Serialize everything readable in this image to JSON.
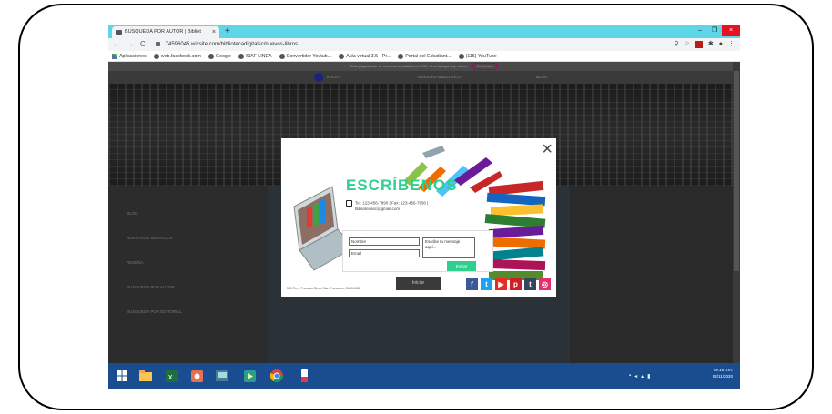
{
  "browser": {
    "tab_title": "BUSQUEDA POR AUTOR | Bibliot",
    "tab_close": "×",
    "new_tab": "+",
    "window_controls": {
      "minimize": "–",
      "maximize": "❐",
      "close": "×"
    },
    "nav": {
      "back": "←",
      "forward": "→",
      "reload": "C"
    },
    "url": "74596045.wixsite.com/bibliotecadigitalsc/nuevos-libros",
    "right_icons": [
      "search-icon",
      "star-icon",
      "extension-icon",
      "puzzle-icon",
      "profile-icon",
      "menu-icon"
    ],
    "right_icon_glyphs": {
      "search": "⚲",
      "star": "☆",
      "puzzle": "✱",
      "profile": "●",
      "menu": "⋮"
    },
    "bookmarks": [
      {
        "label": "Aplicaciones"
      },
      {
        "label": "web.facebook.com"
      },
      {
        "label": "Google"
      },
      {
        "label": "SIAF LINEA"
      },
      {
        "label": "Convertidor Youtub..."
      },
      {
        "label": "Aula virtual 3.5 - Pr..."
      },
      {
        "label": "Portal del Estudiant..."
      },
      {
        "label": "(115) YouTube"
      }
    ]
  },
  "site": {
    "promo_text": "Esta página web se creó con la plataforma WIX. Crea la tuya hoy mismo",
    "promo_button": "Comenzar",
    "nav": [
      "INICIO",
      "NUESTRA BIBLIOTECA",
      "BLOG"
    ],
    "sidebar": [
      "BLOG",
      "NUESTROS SERVICIOS",
      "RESEÑA",
      "BUSQUEDA POR AUTOR",
      "BUSQUEDA POR EDITORIAL"
    ]
  },
  "modal": {
    "close": "×",
    "title": "ESCRÍBENOS",
    "contact_line1": "Tel: 123-456-7890 | Fax: 123-456-7890 |",
    "contact_line2": "Bibliotecasc@gmail.com",
    "name_placeholder": "Nombre",
    "email_placeholder": "Email",
    "message_placeholder": "Escribe tu mensaje aquí...",
    "send_label": "Enviar",
    "mid_button": "Iniciar",
    "footnote": "500 Terry Francois Street San Francisco, CA 94158",
    "social": [
      {
        "icon": "facebook-icon",
        "glyph": "f",
        "color": "#3b5998"
      },
      {
        "icon": "twitter-icon",
        "glyph": "t",
        "color": "#1da1f2"
      },
      {
        "icon": "youtube-icon",
        "glyph": "▶",
        "color": "#e52d27"
      },
      {
        "icon": "pinterest-icon",
        "glyph": "p",
        "color": "#cb2027"
      },
      {
        "icon": "tumblr-icon",
        "glyph": "t",
        "color": "#35465c"
      },
      {
        "icon": "instagram-icon",
        "glyph": "◎",
        "color": "#e1306c"
      }
    ],
    "accent": "#2ecf8f"
  },
  "taskbar": {
    "apps": [
      "start-icon",
      "file-explorer-icon",
      "excel-icon",
      "media-player-icon",
      "network-app-icon",
      "video-app-icon",
      "chrome-icon",
      "paint-app-icon"
    ],
    "time": "09:19 p.m.",
    "date": "02/11/2020"
  }
}
